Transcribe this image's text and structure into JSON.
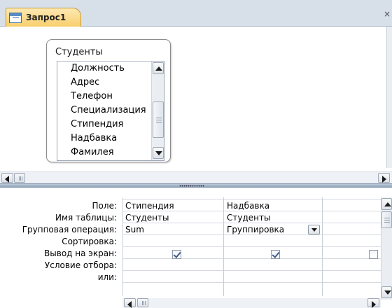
{
  "tab": {
    "title": "Запрос1",
    "close_glyph": "×"
  },
  "table_box": {
    "title": "Студенты",
    "fields": [
      "Должность",
      "Адрес",
      "Телефон",
      "Специализация",
      "Стипендия",
      "Надбавка",
      "Фамилея"
    ]
  },
  "grid": {
    "row_labels": [
      "Поле:",
      "Имя таблицы:",
      "Групповая операция:",
      "Сортировка:",
      "Вывод на экран:",
      "Условие отбора:",
      "или:"
    ],
    "columns": [
      {
        "field": "Стипендия",
        "table": "Студенты",
        "group_op": "Sum",
        "sort": "",
        "show": true,
        "criteria": "",
        "or": ""
      },
      {
        "field": "Надбавка",
        "table": "Студенты",
        "group_op": "Группировка",
        "sort": "",
        "show": true,
        "criteria": "",
        "or": ""
      },
      {
        "field": "",
        "table": "",
        "group_op": "",
        "sort": "",
        "show": false,
        "criteria": "",
        "or": ""
      }
    ]
  },
  "icons": {
    "tab": "query-icon",
    "scroll_up": "arrow-up-icon",
    "scroll_down": "arrow-down-icon",
    "scroll_left": "arrow-left-icon",
    "scroll_right": "arrow-right-icon",
    "dropdown": "chevron-down-icon",
    "checkbox": "checkbox-icon"
  }
}
